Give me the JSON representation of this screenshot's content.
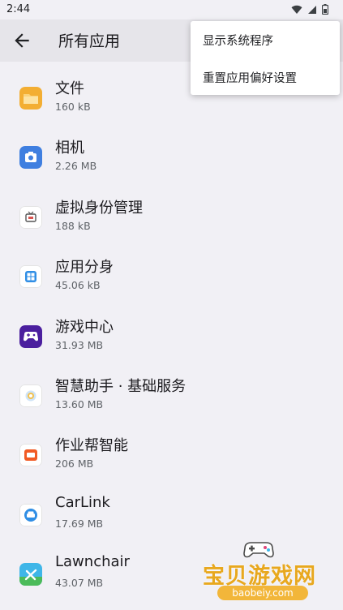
{
  "status_bar": {
    "time": "2:44",
    "icons": [
      "wifi-icon",
      "signal-icon",
      "battery-icon"
    ]
  },
  "header": {
    "title": "所有应用",
    "back_icon": "arrow-back-icon"
  },
  "menu": {
    "items": [
      {
        "label": "显示系统程序"
      },
      {
        "label": "重置应用偏好设置"
      }
    ]
  },
  "apps": [
    {
      "name": "文件",
      "size": "160 kB",
      "icon": "folder-icon",
      "color": "#f3ae33"
    },
    {
      "name": "相机",
      "size": "2.26 MB",
      "icon": "camera-icon",
      "color": "#3f7fe0"
    },
    {
      "name": "虚拟身份管理",
      "size": "188 kB",
      "icon": "tv-icon",
      "color": "#ffffff"
    },
    {
      "name": "应用分身",
      "size": "45.06 kB",
      "icon": "grid-icon",
      "color": "#ffffff"
    },
    {
      "name": "游戏中心",
      "size": "31.93 MB",
      "icon": "gamepad-icon",
      "color": "#4b1f9e"
    },
    {
      "name": "智慧助手 · 基础服务",
      "size": "13.60 MB",
      "icon": "assistant-icon",
      "color": "#ffffff"
    },
    {
      "name": "作业帮智能",
      "size": "206 MB",
      "icon": "zuoyebang-icon",
      "color": "#ffffff"
    },
    {
      "name": "CarLink",
      "size": "17.69 MB",
      "icon": "car-icon",
      "color": "#ffffff"
    },
    {
      "name": "Lawnchair",
      "size": "43.07 MB",
      "icon": "lawnchair-icon",
      "color": "#3fb6e8"
    }
  ],
  "watermark": {
    "title": "宝贝游戏网",
    "url": "baobeiy.com"
  }
}
